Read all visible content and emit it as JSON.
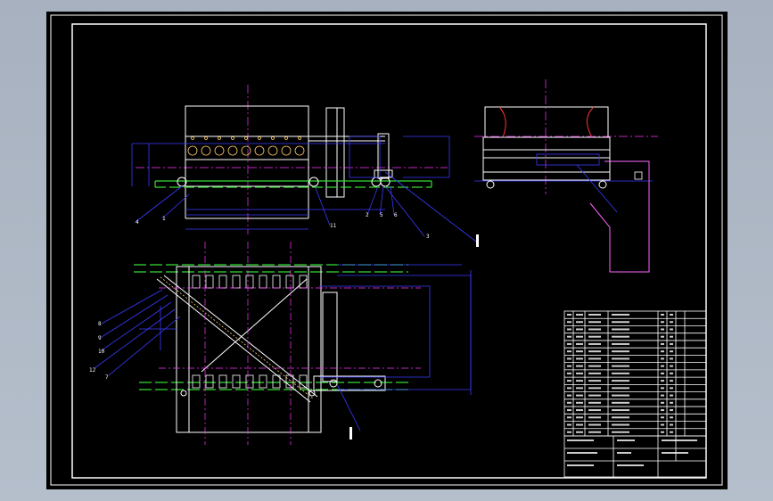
{
  "sheet": {
    "background": "#000000",
    "frame_color": "#ffffff"
  },
  "colors": {
    "structure": "#ffffff",
    "dimension": "#3a3aff",
    "centerline": "#ff33ff",
    "rail": "#33dd33",
    "hidden": "#ff66ff",
    "detail": "#ffcc66",
    "accent": "#ff3333",
    "yellow": "#ffff66"
  },
  "balloons": {
    "front_view": [
      "4",
      "1",
      "11",
      "2",
      "5",
      "6",
      "3"
    ],
    "plan_view": [
      "8",
      "9",
      "10",
      "12",
      "7"
    ]
  },
  "title_block": {
    "name": "title-block",
    "bom_rows": 17
  }
}
